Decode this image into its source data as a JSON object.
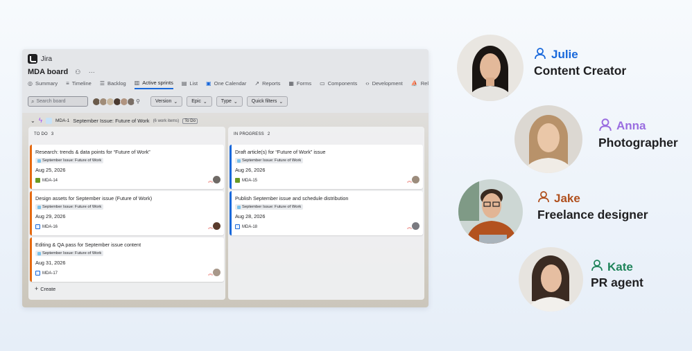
{
  "app": {
    "name": "Jira"
  },
  "board": {
    "title": "MDA board"
  },
  "tabs": [
    {
      "label": "Summary",
      "icon": "globe-icon"
    },
    {
      "label": "Timeline",
      "icon": "timeline-icon"
    },
    {
      "label": "Backlog",
      "icon": "backlog-icon"
    },
    {
      "label": "Active sprints",
      "icon": "board-icon"
    },
    {
      "label": "List",
      "icon": "list-icon"
    },
    {
      "label": "One Calendar",
      "icon": "calendar-icon"
    },
    {
      "label": "Reports",
      "icon": "reports-icon"
    },
    {
      "label": "Forms",
      "icon": "forms-icon"
    },
    {
      "label": "Components",
      "icon": "components-icon"
    },
    {
      "label": "Development",
      "icon": "code-icon"
    },
    {
      "label": "Releases",
      "icon": "ship-icon"
    }
  ],
  "toolbar": {
    "search_placeholder": "Search board",
    "filters": [
      "Version",
      "Epic",
      "Type",
      "Quick filters"
    ]
  },
  "sprint": {
    "key": "MDA-1",
    "name": "September Issue: Future of Work",
    "count": "(6 work items)",
    "status": "To Do"
  },
  "columns": [
    {
      "title": "TO DO",
      "count": "3",
      "cards": [
        {
          "title": "Research: trends & data points for “Future of Work”",
          "tag": "September Issue: Future of Work",
          "date": "Aug 25, 2026",
          "key": "MDA-14",
          "type": "story"
        },
        {
          "title": "Design assets for September issue (Future of Work)",
          "tag": "September Issue: Future of Work",
          "date": "Aug 29, 2026",
          "key": "MDA-16",
          "type": "task"
        },
        {
          "title": "Editing & QA pass for September issue content",
          "tag": "September Issue: Future of Work",
          "date": "Aug 31, 2026",
          "key": "MDA-17",
          "type": "task"
        }
      ]
    },
    {
      "title": "IN PROGRESS",
      "count": "2",
      "cards": [
        {
          "title": "Draft article(s) for “Future of Work” issue",
          "tag": "September Issue: Future of Work",
          "date": "Aug 26, 2026",
          "key": "MDA-15",
          "type": "story"
        },
        {
          "title": "Publish September issue and schedule distribution",
          "tag": "September Issue: Future of Work",
          "date": "Aug 28, 2026",
          "key": "MDA-18",
          "type": "task"
        }
      ]
    }
  ],
  "create_label": "Create",
  "people": [
    {
      "name": "Julie",
      "role": "Content Creator",
      "color": "#1868db"
    },
    {
      "name": "Anna",
      "role": "Photographer",
      "color": "#9a6de0"
    },
    {
      "name": "Jake",
      "role": "Freelance designer",
      "color": "#b0501e"
    },
    {
      "name": "Kate",
      "role": "PR agent",
      "color": "#1f845a"
    }
  ]
}
